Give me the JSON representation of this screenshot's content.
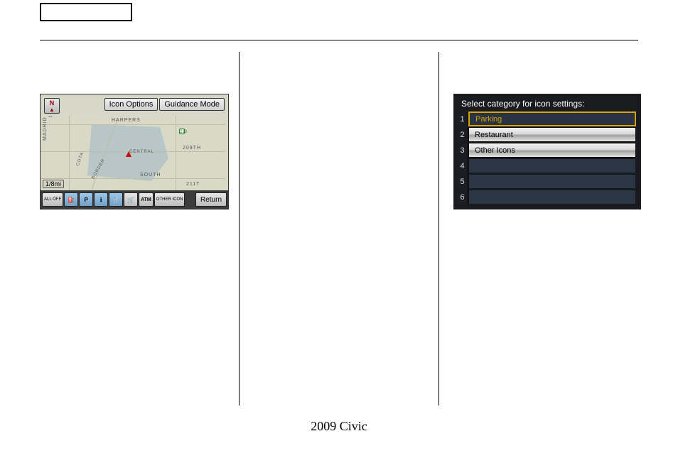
{
  "top_box_label": "",
  "footer": "2009  Civic",
  "map": {
    "buttons": {
      "icon_options": "Icon Options",
      "guidance_mode": "Guidance Mode",
      "return": "Return",
      "other_icon": "OTHER\nICON",
      "all_off": "ALL\nOFF"
    },
    "compass": "N",
    "scale": "1/8mi",
    "labels": {
      "harpers": "HARPERS",
      "south": "SOUTH",
      "central": "CENTRAL",
      "madrid": "MADRID",
      "cota": "COTA",
      "border": "BORDER",
      "st209": "209TH",
      "st211": "211T",
      "be": "BE",
      "route": "213"
    },
    "toolbar_icons": [
      "all-off",
      "gas",
      "parking",
      "info",
      "restaurant",
      "shopping",
      "atm",
      "other-icon"
    ]
  },
  "category": {
    "header": "Select category for icon settings:",
    "rows": [
      {
        "n": "1",
        "label": "Parking",
        "selected": true
      },
      {
        "n": "2",
        "label": "Restaurant",
        "selected": false
      },
      {
        "n": "3",
        "label": "Other Icons",
        "selected": false
      },
      {
        "n": "4",
        "label": "",
        "selected": false
      },
      {
        "n": "5",
        "label": "",
        "selected": false
      },
      {
        "n": "6",
        "label": "",
        "selected": false
      }
    ]
  }
}
